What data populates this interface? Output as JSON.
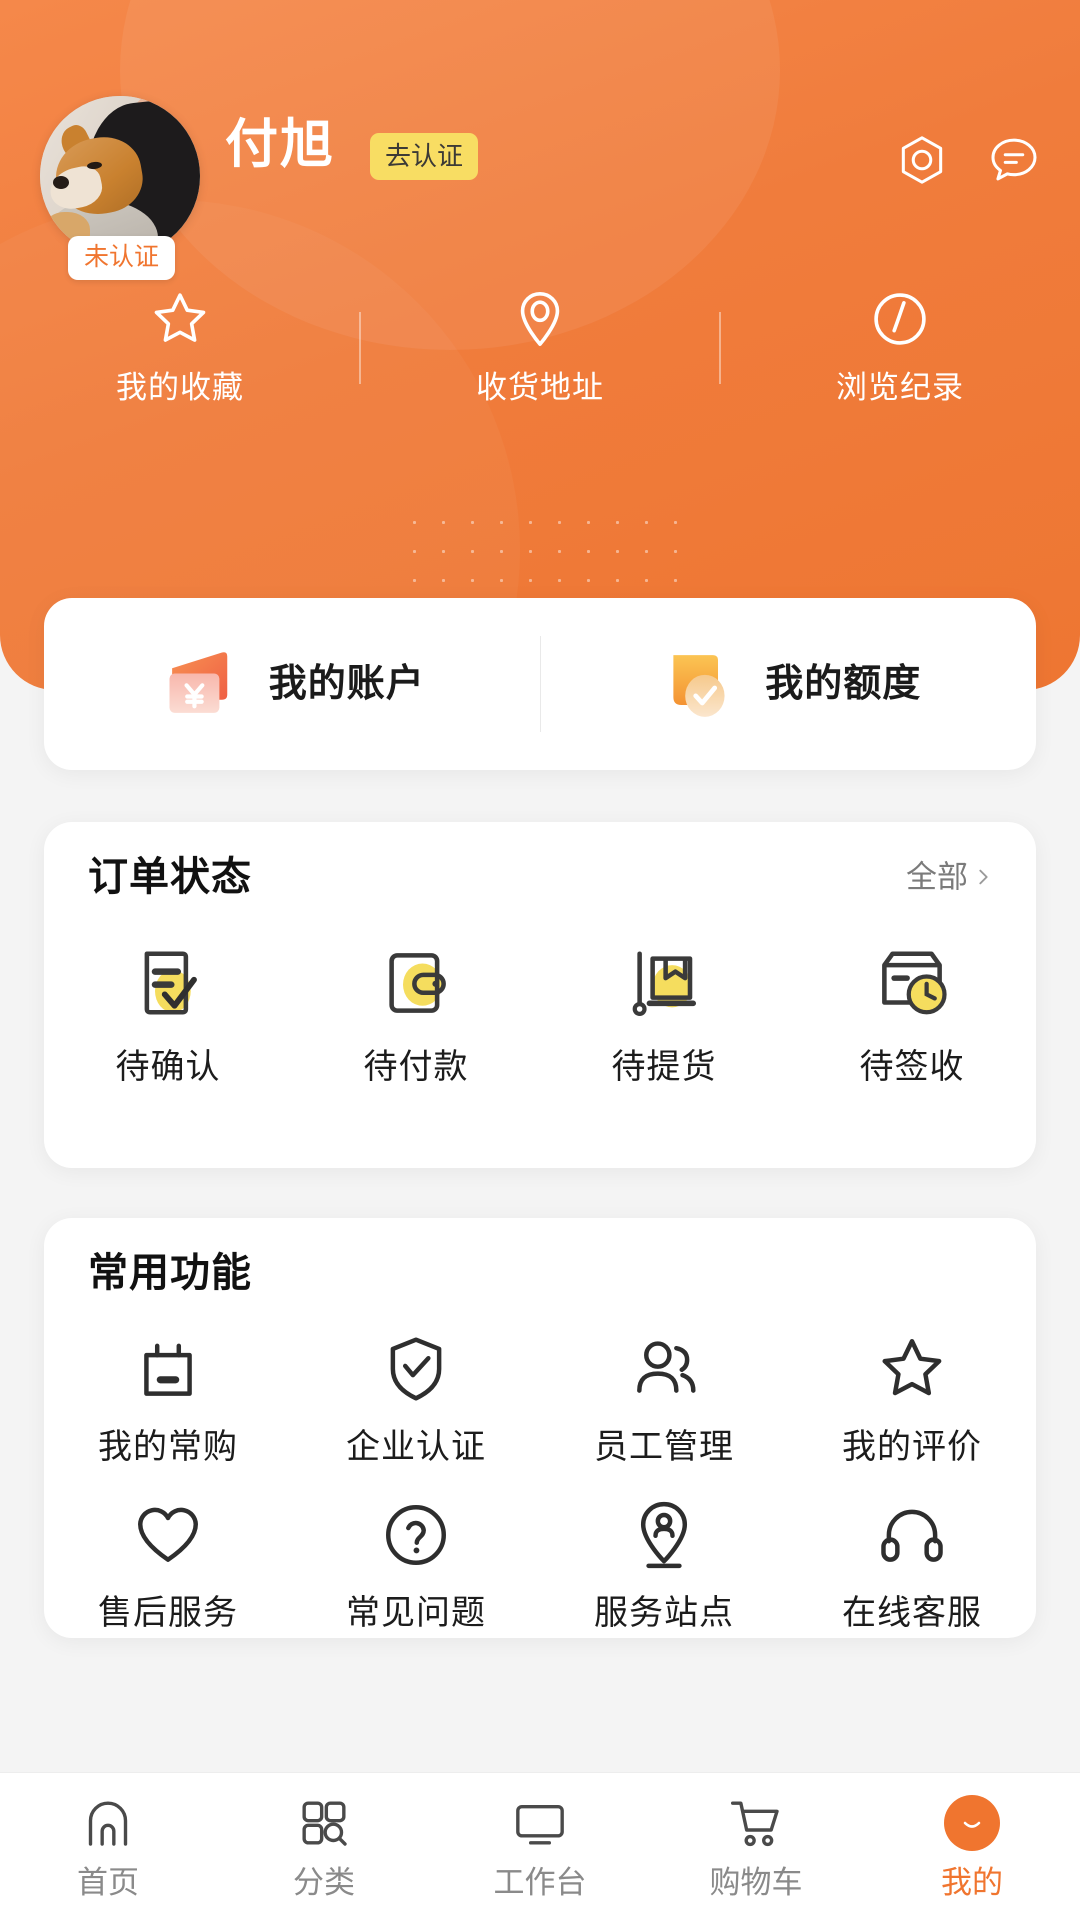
{
  "theme": {
    "brand_orange": "#ee7632",
    "accent_yellow": "#f8dd63",
    "order_icon_yellow": "#f5dd5e",
    "muted_text": "#8a8a8a"
  },
  "header": {
    "user_name": "付旭",
    "verify_button": "去认证",
    "avatar_badge": "未认证",
    "icons": {
      "settings": "gear-icon",
      "message": "chat-bubble-icon"
    },
    "quick_links": [
      {
        "label": "我的收藏",
        "icon": "star-icon"
      },
      {
        "label": "收货地址",
        "icon": "location-pin-icon"
      },
      {
        "label": "浏览纪录",
        "icon": "history-clock-icon"
      }
    ]
  },
  "account_card": {
    "items": [
      {
        "label": "我的账户",
        "icon": "wallet-yen-icon"
      },
      {
        "label": "我的额度",
        "icon": "credit-check-icon"
      }
    ]
  },
  "order_status": {
    "title": "订单状态",
    "all_label": "全部",
    "all_chevron": "chevron-right-icon",
    "items": [
      {
        "label": "待确认",
        "icon": "document-check-icon"
      },
      {
        "label": "待付款",
        "icon": "wallet-icon"
      },
      {
        "label": "待提货",
        "icon": "dolly-box-icon"
      },
      {
        "label": "待签收",
        "icon": "delivery-clock-icon"
      }
    ]
  },
  "common_functions": {
    "title": "常用功能",
    "items": [
      {
        "label": "我的常购",
        "icon": "shopping-bag-icon"
      },
      {
        "label": "企业认证",
        "icon": "shield-check-icon"
      },
      {
        "label": "员工管理",
        "icon": "users-icon"
      },
      {
        "label": "我的评价",
        "icon": "star-outline-icon"
      },
      {
        "label": "售后服务",
        "icon": "heart-icon"
      },
      {
        "label": "常见问题",
        "icon": "question-circle-icon"
      },
      {
        "label": "服务站点",
        "icon": "map-pin-user-icon"
      },
      {
        "label": "在线客服",
        "icon": "headset-icon"
      }
    ]
  },
  "tabbar": {
    "items": [
      {
        "label": "首页",
        "icon": "home-icon",
        "active": false
      },
      {
        "label": "分类",
        "icon": "category-grid-icon",
        "active": false
      },
      {
        "label": "工作台",
        "icon": "monitor-icon",
        "active": false
      },
      {
        "label": "购物车",
        "icon": "cart-icon",
        "active": false
      },
      {
        "label": "我的",
        "icon": "profile-avatar-icon",
        "active": true
      }
    ]
  }
}
